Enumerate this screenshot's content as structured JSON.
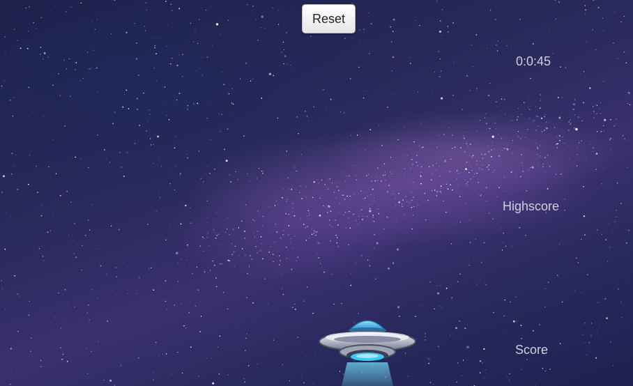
{
  "toolbar": {
    "reset_label": "Reset"
  },
  "hud": {
    "timer": "0:0:45",
    "highscore_label": "Highscore",
    "score_label": "Score"
  },
  "player": {
    "icon": "ufo-icon"
  },
  "colors": {
    "sky_dark": "#1c2148",
    "nebula_purple": "#9664be",
    "ufo_dome": "#3fb6f0",
    "ufo_beam": "#6fd8f5",
    "hud_text": "#cfcfe0"
  }
}
